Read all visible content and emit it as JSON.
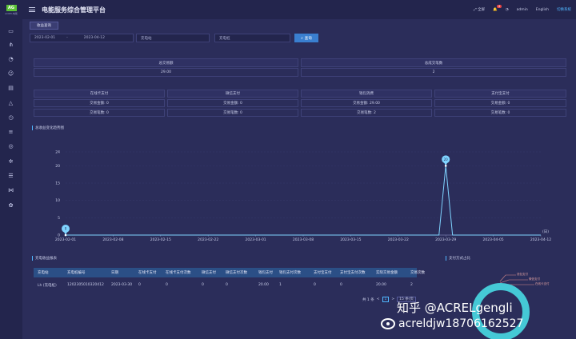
{
  "header": {
    "logo_text": "AG",
    "logo_sub": "ACREL电能",
    "title": "电能服务综合管理平台",
    "fullscreen": "全屏",
    "notif_count": "4",
    "user": "admin",
    "lang_en": "English",
    "lang_cn": "切换系统"
  },
  "sidebar": {
    "icons": [
      "monitor-icon",
      "network-icon",
      "chart-icon",
      "users-icon",
      "file-icon",
      "alert-icon",
      "clock-icon",
      "database-icon",
      "location-icon",
      "gear-icon",
      "list-icon",
      "tree-icon",
      "settings-icon"
    ]
  },
  "tab": {
    "label": "收益查询"
  },
  "filters": {
    "date_start": "2023-02-01",
    "date_sep": "-",
    "date_end": "2023-04-12",
    "station": "充电站",
    "pile": "充电桩",
    "query_label": "查询"
  },
  "summary": {
    "total_amount_label": "总交易额",
    "total_amount_value": "29.00",
    "total_count_label": "总成交笔数",
    "total_count_value": "2"
  },
  "payments": [
    {
      "title": "在线卡支付",
      "amount_label": "交易金额:",
      "amount": "0",
      "count_label": "交易笔数:",
      "count": "0"
    },
    {
      "title": "微信支付",
      "amount_label": "交易金额:",
      "amount": "0",
      "count_label": "交易笔数:",
      "count": "0"
    },
    {
      "title": "钱包消费",
      "amount_label": "交易金额:",
      "amount": "29.00",
      "count_label": "交易笔数:",
      "count": "2"
    },
    {
      "title": "支付宝支付",
      "amount_label": "交易金额:",
      "amount": "0",
      "count_label": "交易笔数:",
      "count": "0"
    }
  ],
  "chart_title": "总收益变化趋势图",
  "chart_data": {
    "type": "line",
    "title": "总收益变化趋势图",
    "xlabel": "(日)",
    "ylabel": "",
    "x_ticks": [
      "2023-02-01",
      "2023-02-08",
      "2023-02-15",
      "2023-02-22",
      "2023-03-01",
      "2023-03-08",
      "2023-03-15",
      "2023-03-22",
      "2023-03-29",
      "2023-04-05",
      "2023-04-12"
    ],
    "y_ticks": [
      0,
      5,
      10,
      15,
      20,
      24
    ],
    "ylim": [
      0,
      24
    ],
    "points": [
      {
        "x": "2023-02-01",
        "y": 0
      },
      {
        "x": "2023-03-28",
        "y": 0
      },
      {
        "x": "2023-03-29",
        "y": 20
      },
      {
        "x": "2023-03-30",
        "y": 0
      },
      {
        "x": "2023-04-12",
        "y": 0
      }
    ],
    "markers": [
      {
        "x": "2023-02-01",
        "y": 0,
        "label": "0"
      },
      {
        "x": "2023-03-29",
        "y": 20,
        "label": "20"
      }
    ],
    "color": "#7fd3ff"
  },
  "table_section": "充电收益报表",
  "table": {
    "headers": [
      "充电站",
      "充电桩编号",
      "日期",
      "在线卡支付",
      "在线卡支付次数",
      "微信支付",
      "微信支付次数",
      "钱包支付",
      "钱包支付次数",
      "支付宝支付",
      "支付宝支付次数",
      "实际交易金额",
      "交易次数"
    ],
    "rows": [
      [
        "Lh (充电桩)",
        "1202305010320412",
        "2023-03-30",
        "0",
        "0",
        "0",
        "0",
        "20.00",
        "1",
        "0",
        "0",
        "20.00",
        "2"
      ]
    ]
  },
  "pagination": {
    "total": "共 1 条",
    "prev": "<",
    "page": "1",
    "next": ">",
    "page_size": "15 条/页"
  },
  "pie_section": "支付方式占比",
  "pie_labels": [
    "钱包支付",
    "微信支付",
    "在线卡支付"
  ],
  "watermark": {
    "line1": "知乎 @ACRELgengli",
    "line2": "acreldjw18706162527"
  }
}
